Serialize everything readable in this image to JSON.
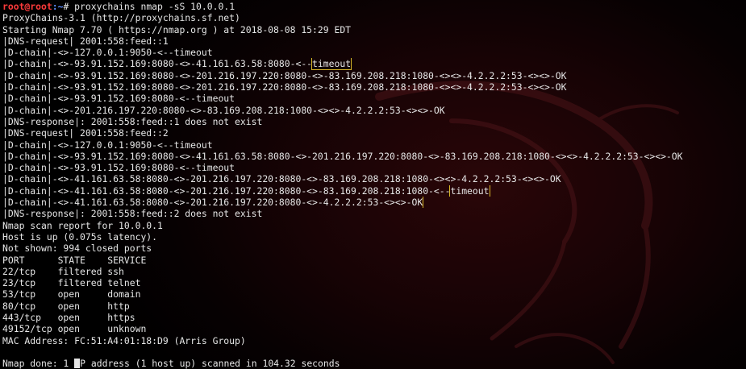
{
  "prompt": {
    "user_host": "root@root",
    "path": ":~",
    "symbol": "# ",
    "command": "proxychains nmap -sS 10.0.0.1"
  },
  "output": [
    "ProxyChains-3.1 (http://proxychains.sf.net)",
    "Starting Nmap 7.70 ( https://nmap.org ) at 2018-08-08 15:29 EDT",
    "|DNS-request| 2001:558:feed::1",
    "|D-chain|-<>-127.0.0.1:9050-<--timeout",
    {
      "pre": "|D-chain|-<>-93.91.152.169:8080-<>-41.161.63.58:8080-<--",
      "hl": "timeout"
    },
    "|D-chain|-<>-93.91.152.169:8080-<>-201.216.197.220:8080-<>-83.169.208.218:1080-<><>-4.2.2.2:53-<><>-OK",
    "|D-chain|-<>-93.91.152.169:8080-<>-201.216.197.220:8080-<>-83.169.208.218:1080-<><>-4.2.2.2:53-<><>-OK",
    "|D-chain|-<>-93.91.152.169:8080-<--timeout",
    "|D-chain|-<>-201.216.197.220:8080-<>-83.169.208.218:1080-<><>-4.2.2.2:53-<><>-OK",
    "|DNS-response|: 2001:558:feed::1 does not exist",
    "|DNS-request| 2001:558:feed::2",
    "|D-chain|-<>-127.0.0.1:9050-<--timeout",
    "|D-chain|-<>-93.91.152.169:8080-<>-41.161.63.58:8080-<>-201.216.197.220:8080-<>-83.169.208.218:1080-<><>-4.2.2.2:53-<><>-OK",
    "|D-chain|-<>-93.91.152.169:8080-<--timeout",
    "|D-chain|-<>-41.161.63.58:8080-<>-201.216.197.220:8080-<>-83.169.208.218:1080-<><>-4.2.2.2:53-<><>-OK",
    {
      "pre": "|D-chain|-<>-41.161.63.58:8080-<>-201.216.197.220:8080-<>-83.169.208.218:1080-<--",
      "hl": "timeout"
    },
    {
      "pre": "",
      "hl": "|D-chain|-<>-41.161.63.58:8080-<>-201.216.197.220:8080-<>-4.2.2.2:53-<><>-OK"
    },
    "|DNS-response|: 2001:558:feed::2 does not exist",
    "Nmap scan report for 10.0.0.1",
    "Host is up (0.075s latency).",
    "Not shown: 994 closed ports",
    "PORT      STATE    SERVICE",
    "22/tcp    filtered ssh",
    "23/tcp    filtered telnet",
    "53/tcp    open     domain",
    "80/tcp    open     http",
    "443/tcp   open     https",
    "49152/tcp open     unknown",
    "MAC Address: FC:51:A4:01:18:D9 (Arris Group)",
    "",
    {
      "pre": "Nmap done: 1 ",
      "cursor": true,
      "post": "P address (1 host up) scanned in 104.32 seconds"
    }
  ],
  "colors": {
    "background": "#000000",
    "text": "#e6e6e6",
    "prompt_user": "#ff3b3b",
    "prompt_path": "#5c8bff",
    "highlight_box": "#d8b528"
  },
  "icons": [
    "kali-dragon-watermark"
  ]
}
